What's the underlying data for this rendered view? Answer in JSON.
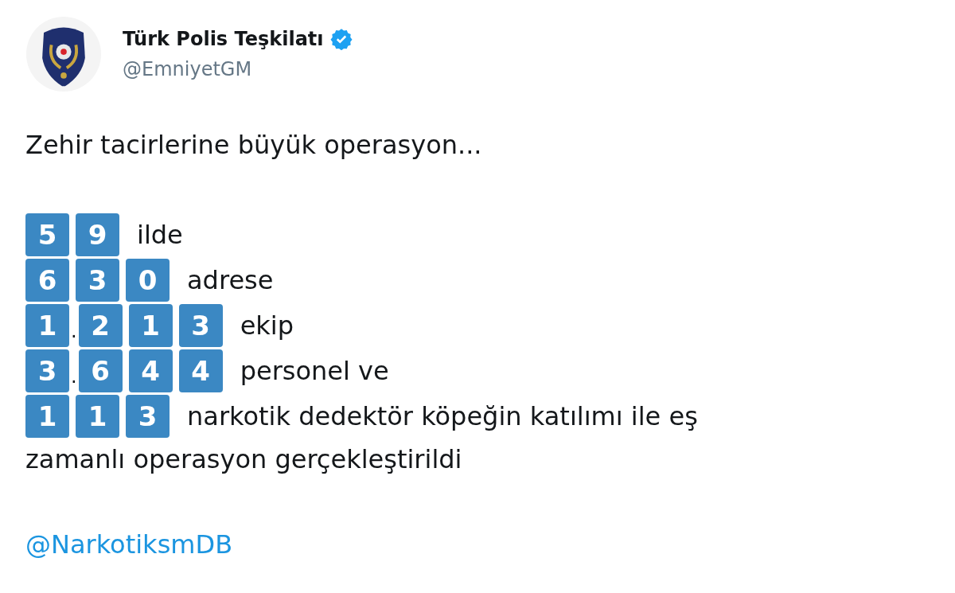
{
  "author": {
    "name": "Türk Polis Teşkilatı",
    "verified": true,
    "handle": "@EmniyetGM"
  },
  "headline": "Zehir tacirlerine büyük operasyon...",
  "lines": [
    {
      "parts": [
        {
          "kind": "keycap",
          "text": "5"
        },
        {
          "kind": "keycap",
          "text": "9"
        }
      ],
      "text": "ilde"
    },
    {
      "parts": [
        {
          "kind": "keycap",
          "text": "6"
        },
        {
          "kind": "keycap",
          "text": "3"
        },
        {
          "kind": "keycap",
          "text": "0"
        }
      ],
      "text": "adrese"
    },
    {
      "parts": [
        {
          "kind": "keycap",
          "text": "1"
        },
        {
          "kind": "plain",
          "text": "."
        },
        {
          "kind": "keycap",
          "text": "2"
        },
        {
          "kind": "keycap",
          "text": "1"
        },
        {
          "kind": "keycap",
          "text": "3"
        }
      ],
      "text": "ekip"
    },
    {
      "parts": [
        {
          "kind": "keycap",
          "text": "3"
        },
        {
          "kind": "plain",
          "text": "."
        },
        {
          "kind": "keycap",
          "text": "6"
        },
        {
          "kind": "keycap",
          "text": "4"
        },
        {
          "kind": "keycap",
          "text": "4"
        }
      ],
      "text": "personel ve"
    },
    {
      "parts": [
        {
          "kind": "keycap",
          "text": "1"
        },
        {
          "kind": "keycap",
          "text": "1"
        },
        {
          "kind": "keycap",
          "text": "3"
        }
      ],
      "text": "narkotik dedektör köpeğin katılımı ile eş",
      "continuation": "zamanlı operasyon gerçekleştirildi"
    }
  ],
  "mention": "@NarkotiksmDB"
}
